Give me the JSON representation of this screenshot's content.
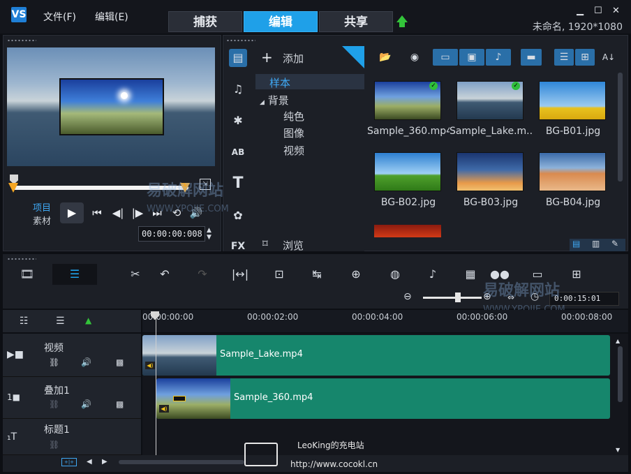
{
  "app": {
    "logo": "VS",
    "title": "未命名, 1920*1080"
  },
  "menu": [
    {
      "label": "文件(F)"
    },
    {
      "label": "编辑(E)"
    }
  ],
  "tabs": [
    {
      "label": "捕获"
    },
    {
      "label": "编辑"
    },
    {
      "label": "共享"
    }
  ],
  "player": {
    "mode_project": "项目",
    "mode_clip": "素材",
    "timecode": "00:00:00:008"
  },
  "library": {
    "add_label": "添加",
    "browse_label": "浏览",
    "tree": [
      {
        "label": "样本"
      },
      {
        "label": "背景"
      },
      {
        "label": "纯色"
      },
      {
        "label": "图像"
      },
      {
        "label": "视频"
      }
    ],
    "thumbnails": [
      {
        "caption": "Sample_360.mp4"
      },
      {
        "caption": "Sample_Lake.m..."
      },
      {
        "caption": "BG-B01.jpg"
      },
      {
        "caption": "BG-B02.jpg"
      },
      {
        "caption": "BG-B03.jpg"
      },
      {
        "caption": "BG-B04.jpg"
      }
    ]
  },
  "timeline": {
    "timecode": "0:00:15:01",
    "ruler": [
      "00:00:00:00",
      "00:00:02:00",
      "00:00:04:00",
      "00:00:06:00",
      "00:00:08:00"
    ],
    "tracks": [
      {
        "name": "视频",
        "clip": "Sample_Lake.mp4"
      },
      {
        "name": "叠加1",
        "clip": "Sample_360.mp4"
      },
      {
        "name": "标题1",
        "clip": ""
      }
    ]
  },
  "watermark": {
    "site": "易破解网站",
    "url": "WWW.YPOJIE.COM",
    "footer_name": "LeoKing的充电站",
    "footer_url": "http://www.cocokl.cn"
  }
}
